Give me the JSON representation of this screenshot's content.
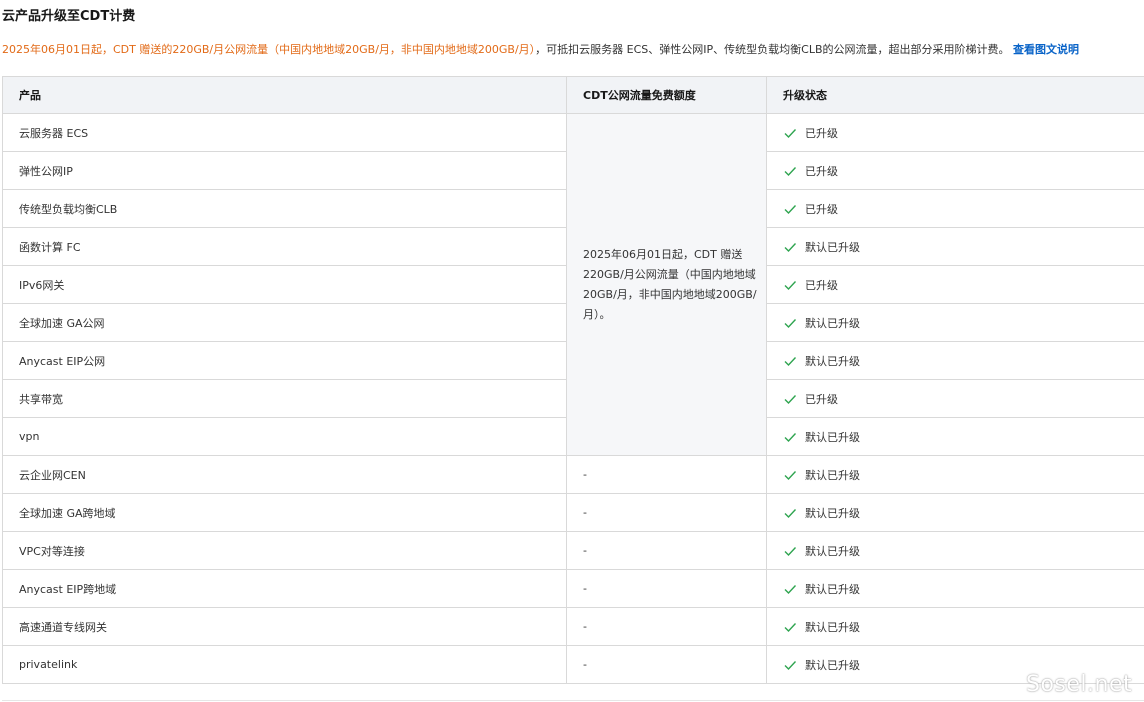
{
  "page": {
    "title": "云产品升级至CDT计费",
    "notice": {
      "highlight": "2025年06月01日起，CDT 赠送的220GB/月公网流量（中国内地地域20GB/月，非中国内地地域200GB/月）",
      "text": "，可抵扣云服务器 ECS、弹性公网IP、传统型负载均衡CLB的公网流量，超出部分采用阶梯计费。",
      "link": "查看图文说明"
    }
  },
  "table": {
    "headers": {
      "product": "产品",
      "quota": "CDT公网流量免费额度",
      "status": "升级状态"
    },
    "quota_merged_text": "2025年06月01日起，CDT 赠送220GB/月公网流量（中国内地地域20GB/月，非中国内地地域200GB/月）。",
    "rows": [
      {
        "product": "云服务器 ECS",
        "quota": null,
        "status": "已升级"
      },
      {
        "product": "弹性公网IP",
        "quota": null,
        "status": "已升级"
      },
      {
        "product": "传统型负载均衡CLB",
        "quota": null,
        "status": "已升级"
      },
      {
        "product": "函数计算 FC",
        "quota": null,
        "status": "默认已升级"
      },
      {
        "product": "IPv6网关",
        "quota": null,
        "status": "已升级"
      },
      {
        "product": "全球加速 GA公网",
        "quota": null,
        "status": "默认已升级"
      },
      {
        "product": "Anycast EIP公网",
        "quota": null,
        "status": "默认已升级"
      },
      {
        "product": "共享带宽",
        "quota": null,
        "status": "已升级"
      },
      {
        "product": "vpn",
        "quota": null,
        "status": "默认已升级"
      },
      {
        "product": "云企业网CEN",
        "quota": "-",
        "status": "默认已升级"
      },
      {
        "product": "全球加速 GA跨地域",
        "quota": "-",
        "status": "默认已升级"
      },
      {
        "product": "VPC对等连接",
        "quota": "-",
        "status": "默认已升级"
      },
      {
        "product": "Anycast EIP跨地域",
        "quota": "-",
        "status": "默认已升级"
      },
      {
        "product": "高速通道专线网关",
        "quota": "-",
        "status": "默认已升级"
      },
      {
        "product": "privatelink",
        "quota": "-",
        "status": "默认已升级"
      }
    ]
  },
  "watermark": "Sosel.net",
  "colors": {
    "accent_orange": "#e26a17",
    "link_blue": "#0a64c8",
    "check_green": "#2ea44f",
    "header_bg": "#f1f3f6"
  },
  "icons": {
    "status": "check-icon"
  }
}
